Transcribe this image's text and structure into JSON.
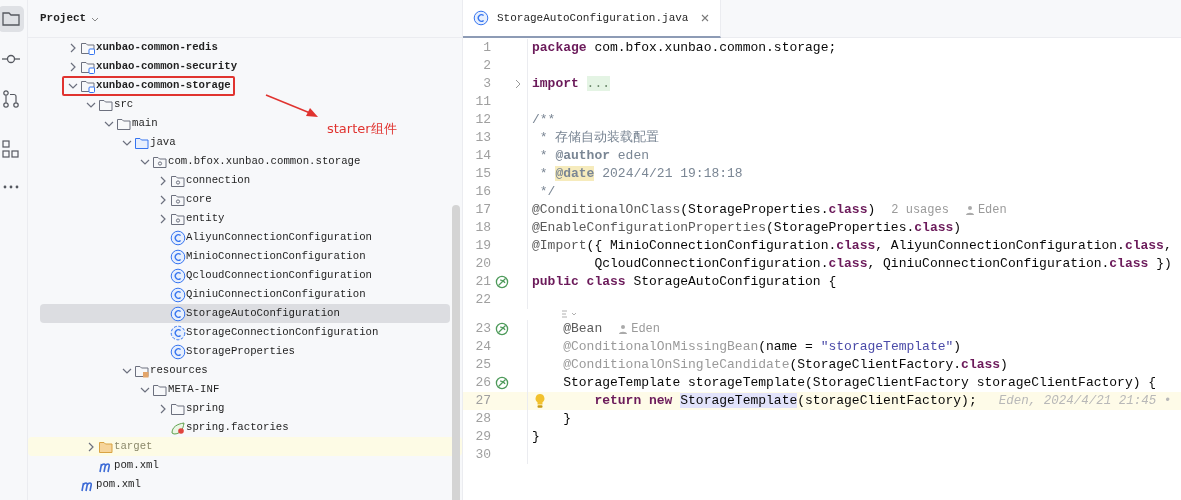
{
  "tool_strip": [
    {
      "kind": "project",
      "selected": true
    },
    {
      "kind": "commit",
      "selected": false
    },
    {
      "kind": "pull-requests",
      "selected": false
    },
    {
      "kind": "structure",
      "selected": false
    },
    {
      "kind": "more",
      "selected": false
    }
  ],
  "project_panel": {
    "title": "Project",
    "items": [
      {
        "label": "xunbao-common-redis",
        "kind": "module",
        "expanded": false,
        "selected": false
      },
      {
        "label": "xunbao-common-security",
        "kind": "module",
        "expanded": false,
        "selected": false
      },
      {
        "label": "xunbao-common-storage",
        "kind": "module",
        "expanded": true,
        "selected": false,
        "boxed": true,
        "children": [
          {
            "label": "src",
            "kind": "folder",
            "expanded": true,
            "selected": false,
            "children": [
              {
                "label": "main",
                "kind": "folder",
                "expanded": true,
                "selected": false,
                "children": [
                  {
                    "label": "java",
                    "kind": "source-folder",
                    "expanded": true,
                    "selected": false,
                    "children": [
                      {
                        "label": "com.bfox.xunbao.common.storage",
                        "kind": "package",
                        "expanded": true,
                        "selected": false,
                        "children": [
                          {
                            "label": "connection",
                            "kind": "package",
                            "expanded": false,
                            "selected": false
                          },
                          {
                            "label": "core",
                            "kind": "package",
                            "expanded": false,
                            "selected": false
                          },
                          {
                            "label": "entity",
                            "kind": "package",
                            "expanded": false,
                            "selected": false
                          },
                          {
                            "label": "AliyunConnectionConfiguration",
                            "kind": "class",
                            "selected": false
                          },
                          {
                            "label": "MinioConnectionConfiguration",
                            "kind": "class",
                            "selected": false
                          },
                          {
                            "label": "QcloudConnectionConfiguration",
                            "kind": "class",
                            "selected": false
                          },
                          {
                            "label": "QiniuConnectionConfiguration",
                            "kind": "class",
                            "selected": false
                          },
                          {
                            "label": "StorageAutoConfiguration",
                            "kind": "class",
                            "selected": true
                          },
                          {
                            "label": "StorageConnectionConfiguration",
                            "kind": "abstract-class",
                            "selected": false
                          },
                          {
                            "label": "StorageProperties",
                            "kind": "class",
                            "selected": false
                          }
                        ]
                      }
                    ]
                  },
                  {
                    "label": "resources",
                    "kind": "resources",
                    "expanded": true,
                    "selected": false,
                    "children": [
                      {
                        "label": "META-INF",
                        "kind": "folder",
                        "expanded": true,
                        "selected": false,
                        "children": [
                          {
                            "label": "spring",
                            "kind": "folder",
                            "expanded": false,
                            "selected": false
                          },
                          {
                            "label": "spring.factories",
                            "kind": "spring-file",
                            "selected": false
                          }
                        ]
                      }
                    ]
                  }
                ]
              }
            ]
          },
          {
            "label": "target",
            "kind": "excluded",
            "expanded": false,
            "selected": false,
            "highlighted": true
          },
          {
            "label": "pom.xml",
            "kind": "maven",
            "selected": false
          }
        ]
      },
      {
        "label": "pom.xml",
        "kind": "maven",
        "selected": false
      }
    ]
  },
  "annotation": {
    "label": "starter组件"
  },
  "editor": {
    "tabs": [
      {
        "label": "StorageAutoConfiguration.java",
        "selected": true
      }
    ],
    "lines": [
      {
        "number": "1",
        "tokens": [
          {
            "text": "package",
            "kind": "keyword"
          },
          {
            "text": " com.bfox.xunbao.common.storage;",
            "kind": "plain"
          }
        ]
      },
      {
        "number": "2"
      },
      {
        "number": "3",
        "fold": true,
        "tokens": [
          {
            "text": "import ",
            "kind": "keyword"
          },
          {
            "text": "...",
            "kind": "folded"
          }
        ]
      },
      {
        "number": "11"
      },
      {
        "number": "12",
        "tokens": [
          {
            "text": "/**",
            "kind": "comment"
          }
        ]
      },
      {
        "number": "13",
        "tokens": [
          {
            "text": " * 存储自动装载配置",
            "kind": "comment"
          }
        ]
      },
      {
        "number": "14",
        "tokens": [
          {
            "text": " * ",
            "kind": "comment"
          },
          {
            "text": "@author",
            "kind": "doctag"
          },
          {
            "text": " eden",
            "kind": "comment"
          }
        ]
      },
      {
        "number": "15",
        "tokens": [
          {
            "text": " * ",
            "kind": "comment"
          },
          {
            "text": "@date",
            "kind": "doctag-marked"
          },
          {
            "text": " 2024/4/21 19:18:18",
            "kind": "comment"
          }
        ]
      },
      {
        "number": "16",
        "tokens": [
          {
            "text": " */",
            "kind": "comment"
          }
        ]
      },
      {
        "number": "17",
        "tokens": [
          {
            "text": "@ConditionalOnClass",
            "kind": "annotation"
          },
          {
            "text": "(StorageProperties.",
            "kind": "plain"
          },
          {
            "text": "class",
            "kind": "keyword"
          },
          {
            "text": ")",
            "kind": "plain"
          }
        ],
        "hints": [
          {
            "kind": "usages",
            "text": "2 usages"
          },
          {
            "kind": "author",
            "text": "Eden"
          }
        ]
      },
      {
        "number": "18",
        "tokens": [
          {
            "text": "@EnableConfigurationProperties",
            "kind": "annotation"
          },
          {
            "text": "(StorageProperties.",
            "kind": "plain"
          },
          {
            "text": "class",
            "kind": "keyword"
          },
          {
            "text": ")",
            "kind": "plain"
          }
        ]
      },
      {
        "number": "19",
        "tokens": [
          {
            "text": "@Import",
            "kind": "annotation"
          },
          {
            "text": "({ MinioConnectionConfiguration.",
            "kind": "plain"
          },
          {
            "text": "class",
            "kind": "keyword"
          },
          {
            "text": ", AliyunConnectionConfiguration.",
            "kind": "plain"
          },
          {
            "text": "class",
            "kind": "keyword"
          },
          {
            "text": ",",
            "kind": "plain"
          }
        ]
      },
      {
        "number": "20",
        "tokens": [
          {
            "text": "        QcloudConnectionConfiguration.",
            "kind": "plain"
          },
          {
            "text": "class",
            "kind": "keyword"
          },
          {
            "text": ", QiniuConnectionConfiguration.",
            "kind": "plain"
          },
          {
            "text": "class",
            "kind": "keyword"
          },
          {
            "text": " })",
            "kind": "plain"
          }
        ]
      },
      {
        "number": "21",
        "bean": true,
        "tokens": [
          {
            "text": "public class",
            "kind": "keyword"
          },
          {
            "text": " StorageAutoConfiguration {",
            "kind": "plain"
          }
        ]
      },
      {
        "number": "22"
      },
      {
        "number": "23",
        "bean": true,
        "inlay_above": true,
        "tokens": [
          {
            "text": "    @Bean",
            "kind": "annotation"
          }
        ],
        "hints": [
          {
            "kind": "author",
            "text": "Eden"
          }
        ]
      },
      {
        "number": "24",
        "tokens": [
          {
            "text": "    @ConditionalOnMissingBean",
            "kind": "annotation-dim"
          },
          {
            "text": "(name = ",
            "kind": "plain"
          },
          {
            "text": "\"storageTemplate\"",
            "kind": "string"
          },
          {
            "text": ")",
            "kind": "plain"
          }
        ]
      },
      {
        "number": "25",
        "tokens": [
          {
            "text": "    @ConditionalOnSingleCandidate",
            "kind": "annotation-dim"
          },
          {
            "text": "(StorageClientFactory.",
            "kind": "plain"
          },
          {
            "text": "class",
            "kind": "keyword"
          },
          {
            "text": ")",
            "kind": "plain"
          }
        ]
      },
      {
        "number": "26",
        "bean": true,
        "tokens": [
          {
            "text": "    StorageTemplate storageTemplate(StorageClientFactory storageClientFactory) {",
            "kind": "plain"
          }
        ]
      },
      {
        "number": "27",
        "current": true,
        "bulb": true,
        "tokens": [
          {
            "text": "        return new ",
            "kind": "keyword"
          },
          {
            "text": "StorageTemplate",
            "kind": "ref-highlight"
          },
          {
            "text": "(storageClientFactory);",
            "kind": "plain"
          }
        ],
        "hints": [
          {
            "kind": "blame",
            "text": "Eden, 2024/4/21 21:45 •"
          }
        ]
      },
      {
        "number": "28",
        "tokens": [
          {
            "text": "    }",
            "kind": "plain"
          }
        ]
      },
      {
        "number": "29",
        "tokens": [
          {
            "text": "}",
            "kind": "plain"
          }
        ]
      },
      {
        "number": "30"
      }
    ]
  }
}
